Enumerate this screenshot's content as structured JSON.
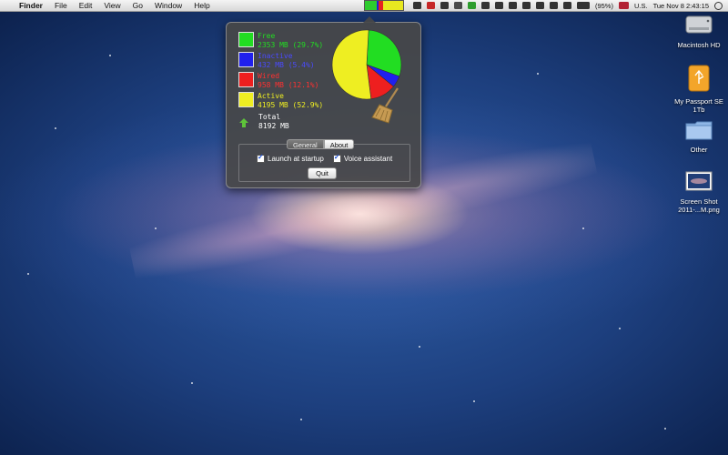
{
  "menubar": {
    "app_name": "Finder",
    "menus": [
      "File",
      "Edit",
      "View",
      "Go",
      "Window",
      "Help"
    ],
    "battery": "(95%)",
    "input_source": "U.S.",
    "clock": "Tue Nov 8  2:43:15"
  },
  "memory_widget": {
    "colors": [
      "#2ecc2e",
      "#1f1fd6",
      "#e82020",
      "#e8e820"
    ]
  },
  "popover": {
    "legend": [
      {
        "name": "Free",
        "value": "2353 MB (29.7%)",
        "color": "#22dd22"
      },
      {
        "name": "Inactive",
        "value": "432 MB (5.4%)",
        "color": "#2020ee"
      },
      {
        "name": "Wired",
        "value": "958 MB (12.1%)",
        "color": "#ee1f1f"
      },
      {
        "name": "Active",
        "value": "4195 MB (52.9%)",
        "color": "#eeee22"
      }
    ],
    "total": {
      "name": "Total",
      "value": "8192 MB"
    },
    "pie_fractions": [
      0.297,
      0.054,
      0.121,
      0.529
    ],
    "tabs": {
      "general": "General",
      "about": "About"
    },
    "launch_at_startup": "Launch at startup",
    "voice_assistant": "Voice assistant",
    "quit_label": "Quit"
  },
  "desktop": {
    "icons": [
      {
        "label": "Macintosh HD"
      },
      {
        "label": "My Passport SE 1Tb"
      },
      {
        "label": "Other"
      },
      {
        "label": "Screen Shot 2011-...M.png"
      }
    ]
  }
}
